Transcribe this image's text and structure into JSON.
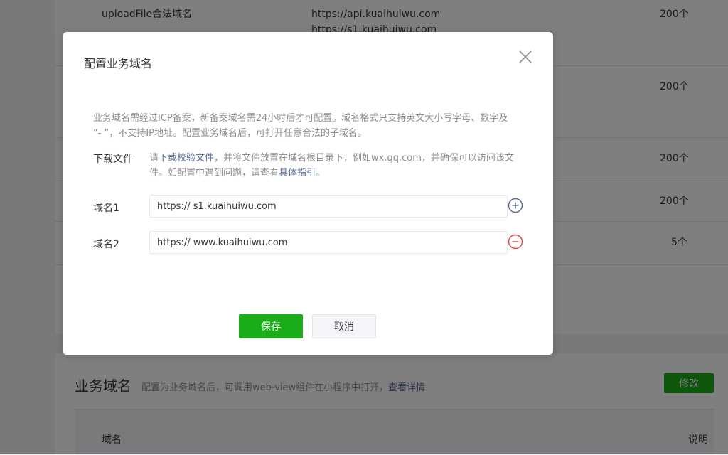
{
  "background": {
    "rows": [
      {
        "name": "uploadFile合法域名",
        "domains": [
          "https://api.kuaihuiwu.com",
          "https://s1.kuaihuiwu.com"
        ],
        "limit": "200个"
      },
      {
        "name": "",
        "domains": [],
        "limit": "200个"
      },
      {
        "name": "",
        "domains": [],
        "limit": "200个"
      },
      {
        "name": "",
        "domains": [],
        "limit": "200个"
      },
      {
        "name": "",
        "domains": [],
        "limit": "5个"
      }
    ],
    "section": {
      "title": "业务域名",
      "desc": "配置为业务域名后，可调用web-view组件在小程序中打开，",
      "desc_link": "查看详情",
      "modify_label": "修改",
      "col_domain": "域名",
      "col_note": "说明"
    }
  },
  "dialog": {
    "title": "配置业务域名",
    "notice_line1": "业务域名需经过ICP备案，新备案域名需24小时后才可配置。域名格式只支持英文大小写字母、数字及",
    "notice_line2": "“- ”，不支持IP地址。配置业务域名后，可打开任意合法的子域名。",
    "download_label": "下载文件",
    "download_prefix": "请",
    "download_link": "下载校验文件",
    "download_middle": "，并将文件放置在域名根目录下，例如wx.qq.com，并确保可以访问该文件。如配置中遇到问题，请查看",
    "guide_link": "具体指引",
    "download_suffix": "。",
    "fields": [
      {
        "label": "域名1",
        "value": "https:// s1.kuaihuiwu.com",
        "action_icon": "plus-circle-icon"
      },
      {
        "label": "域名2",
        "value": "https:// www.kuaihuiwu.com",
        "action_icon": "minus-circle-icon"
      }
    ],
    "save_label": "保存",
    "cancel_label": "取消"
  },
  "colors": {
    "primary": "#1aad19",
    "link": "#576b95",
    "danger": "#e64340",
    "add": "#576b95"
  }
}
